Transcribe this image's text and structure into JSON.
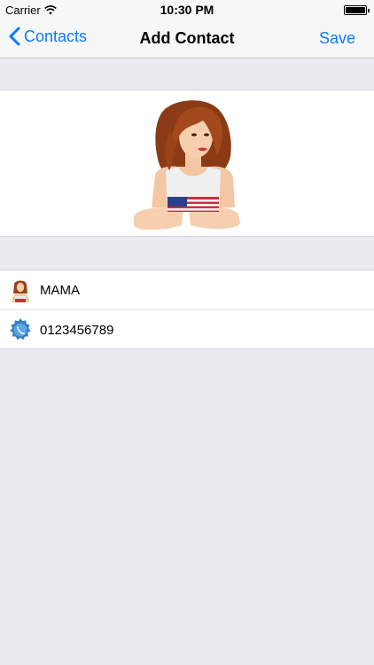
{
  "status_bar": {
    "carrier": "Carrier",
    "time": "10:30 PM"
  },
  "nav": {
    "back_label": "Contacts",
    "title": "Add Contact",
    "save_label": "Save"
  },
  "fields": {
    "name_value": "MAMA",
    "phone_value": "0123456789"
  },
  "colors": {
    "accent": "#0a7bff",
    "background": "#ebebf1"
  }
}
